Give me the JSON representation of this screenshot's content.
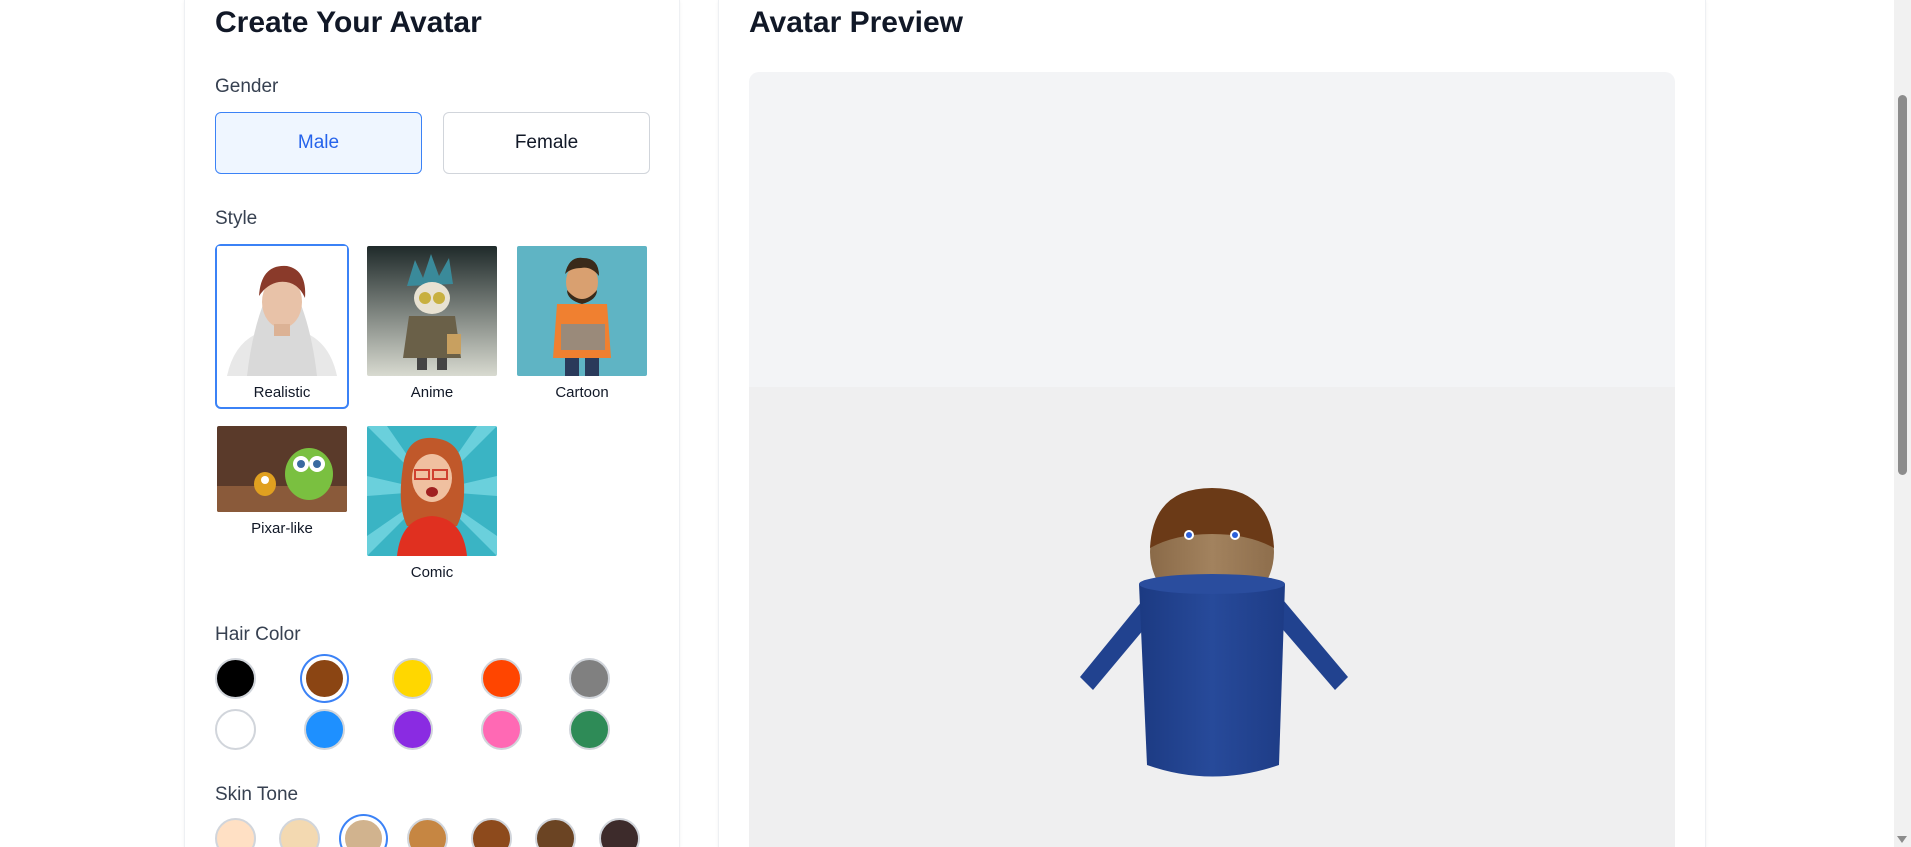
{
  "left": {
    "title": "Create Your Avatar",
    "gender_label": "Gender",
    "gender_options": [
      {
        "label": "Male",
        "selected": true
      },
      {
        "label": "Female",
        "selected": false
      }
    ],
    "style_label": "Style",
    "styles": [
      {
        "label": "Realistic",
        "selected": true
      },
      {
        "label": "Anime",
        "selected": false
      },
      {
        "label": "Cartoon",
        "selected": false
      },
      {
        "label": "Pixar-like",
        "selected": false
      },
      {
        "label": "Comic",
        "selected": false
      }
    ],
    "hair_label": "Hair Color",
    "hair_colors": [
      {
        "color": "#000000",
        "selected": false
      },
      {
        "color": "#8B4513",
        "selected": true
      },
      {
        "color": "#FFD700",
        "selected": false
      },
      {
        "color": "#FF4500",
        "selected": false
      },
      {
        "color": "#808080",
        "selected": false
      },
      {
        "color": "#FFFFFF",
        "selected": false
      },
      {
        "color": "#1E90FF",
        "selected": false
      },
      {
        "color": "#8A2BE2",
        "selected": false
      },
      {
        "color": "#FF69B4",
        "selected": false
      },
      {
        "color": "#2E8B57",
        "selected": false
      }
    ],
    "skin_label": "Skin Tone",
    "skin_tones": [
      {
        "color": "#FFE0C4",
        "selected": false
      },
      {
        "color": "#F3D9B1",
        "selected": false
      },
      {
        "color": "#D1B38E",
        "selected": true
      },
      {
        "color": "#C68642",
        "selected": false
      },
      {
        "color": "#8D4A1C",
        "selected": false
      },
      {
        "color": "#6B4423",
        "selected": false
      },
      {
        "color": "#3D2B2B",
        "selected": false
      }
    ]
  },
  "right": {
    "title": "Avatar Preview"
  },
  "colors": {
    "accent": "#3b82f6",
    "avatar_body": "#22418d",
    "avatar_hair": "#6b3a17",
    "avatar_skin": "#9a7a55"
  }
}
